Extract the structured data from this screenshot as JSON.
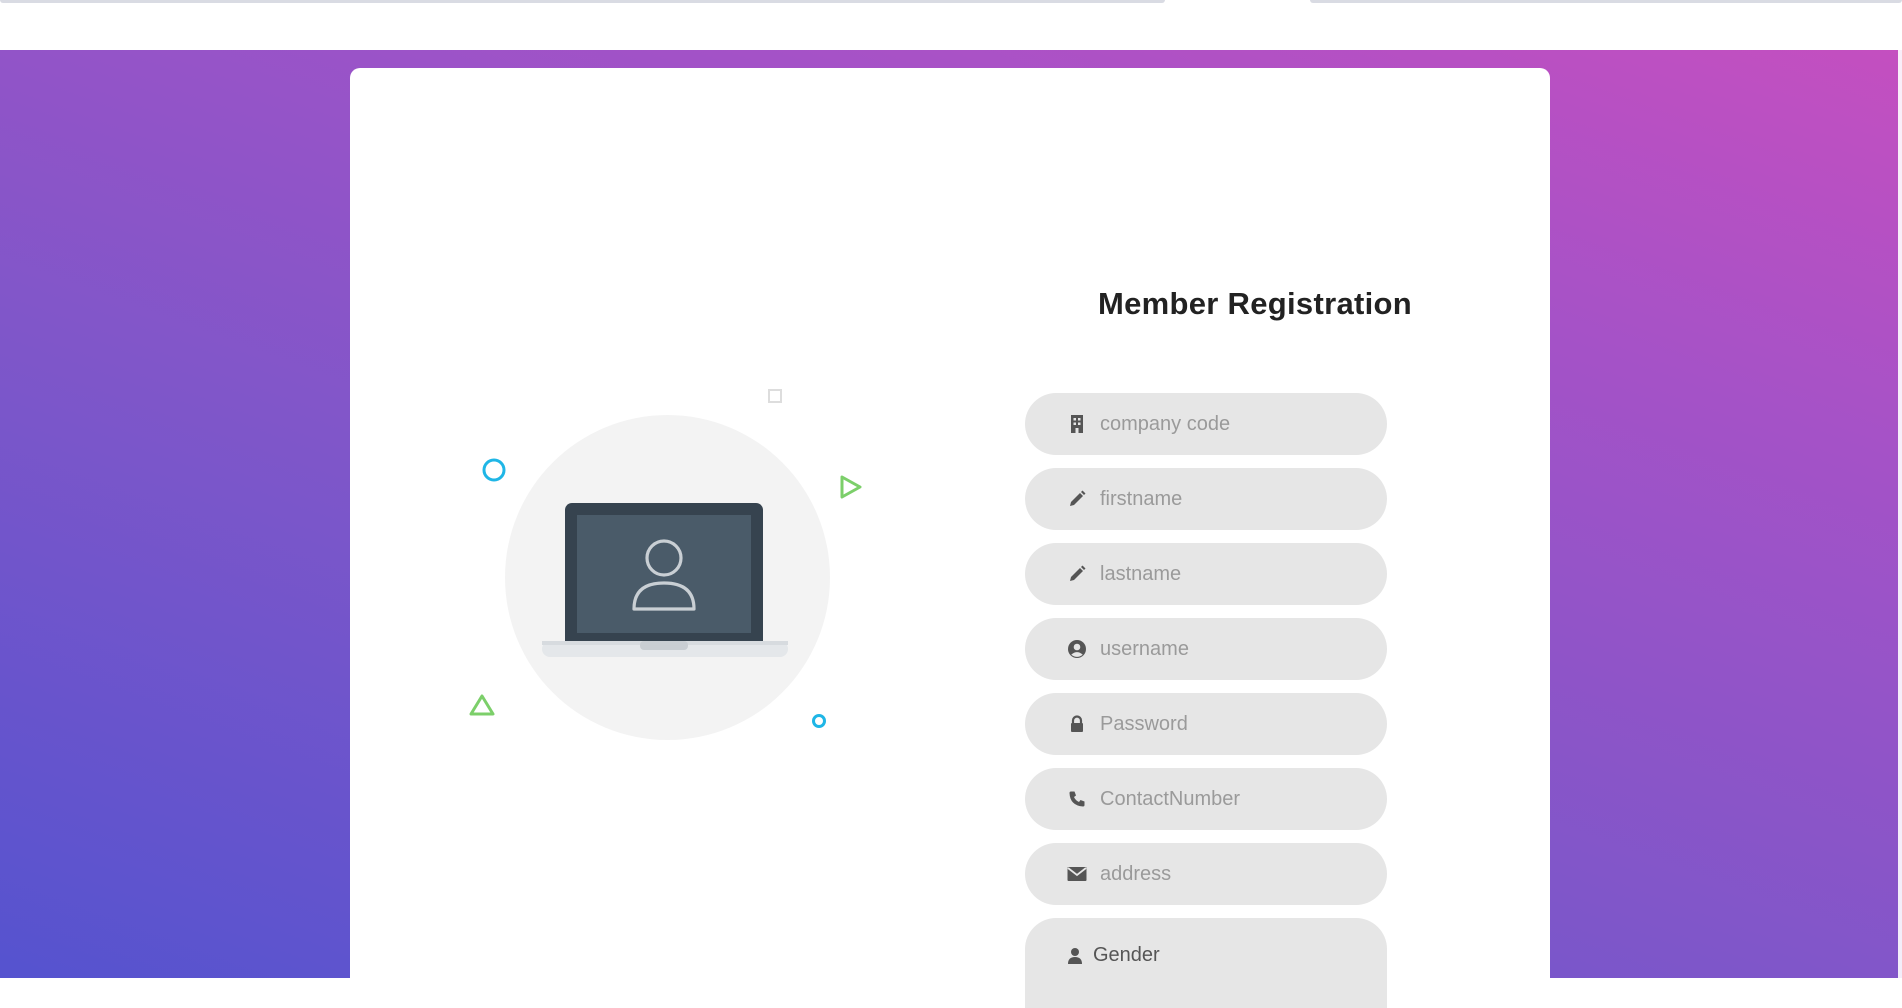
{
  "page": {
    "title": "Member Registration"
  },
  "fields": [
    {
      "id": "company_code",
      "placeholder": "company code",
      "icon": "building-icon"
    },
    {
      "id": "firstname",
      "placeholder": "firstname",
      "icon": "pencil-icon"
    },
    {
      "id": "lastname",
      "placeholder": "lastname",
      "icon": "pencil-icon"
    },
    {
      "id": "username",
      "placeholder": "username",
      "icon": "user-circle-icon"
    },
    {
      "id": "password",
      "placeholder": "Password",
      "icon": "lock-icon"
    },
    {
      "id": "contact_number",
      "placeholder": "ContactNumber",
      "icon": "phone-icon"
    },
    {
      "id": "address",
      "placeholder": "address",
      "icon": "envelope-icon"
    }
  ],
  "gender": {
    "label": "Gender",
    "icon": "user-icon"
  },
  "colors": {
    "gradient_start": "#5553cf",
    "gradient_end": "#c44fc0",
    "field_bg": "#e6e6e6",
    "accent_blue": "#1fb6e6",
    "accent_green": "#7ccf6a"
  }
}
